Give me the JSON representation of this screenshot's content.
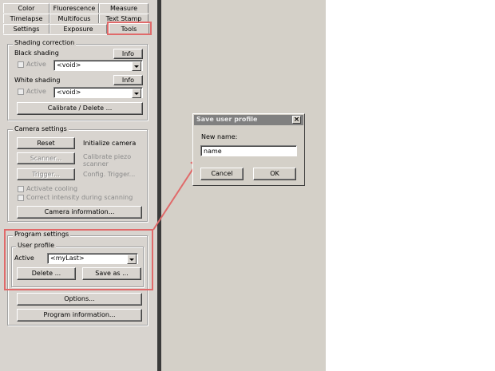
{
  "tabs": {
    "row1": [
      "Color",
      "Fluorescence",
      "Measure"
    ],
    "row2": [
      "Timelapse",
      "Multifocus",
      "Text Stamp"
    ],
    "row3": [
      "Settings",
      "Exposure",
      "Tools"
    ]
  },
  "shading": {
    "title": "Shading correction",
    "black_label": "Black shading",
    "white_label": "White shading",
    "info_label": "Info",
    "active_label": "Active",
    "black_select": "<void>",
    "white_select": "<void>",
    "calibrate_label": "Calibrate / Delete ..."
  },
  "camera": {
    "title": "Camera settings",
    "reset_label": "Reset",
    "initialize_label": "Initialize camera",
    "scanner_label": "Scanner...",
    "calibrate_piezo_label": "Calibrate piezo scanner",
    "trigger_label": "Trigger...",
    "config_trigger_label": "Config. Trigger...",
    "activate_cooling_label": "Activate cooling",
    "correct_intensity_label": "Correct intensity during scanning",
    "info_button_label": "Camera information..."
  },
  "program": {
    "title": "Program settings",
    "profile_title": "User profile",
    "active_label": "Active",
    "profile_select": "<myLast>",
    "delete_label": "Delete ...",
    "saveas_label": "Save as ...",
    "options_label": "Options...",
    "info_label": "Program information..."
  },
  "dialog": {
    "title": "Save user profile",
    "close_glyph": "×",
    "field_label": "New name:",
    "field_value": "name",
    "cancel_label": "Cancel",
    "ok_label": "OK"
  },
  "colors": {
    "highlight": "#e06a6a"
  }
}
